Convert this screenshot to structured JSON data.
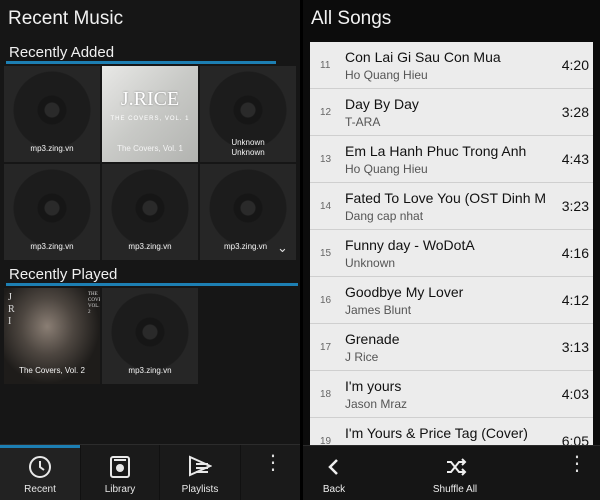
{
  "left_screen": {
    "title": "Recent Music",
    "recently_added": {
      "label": "Recently Added",
      "tiles": [
        {
          "label": "mp3.zing.vn"
        },
        {
          "label": "The Covers, Vol. 1",
          "art_title": "J.RICE",
          "art_sub": "THE COVERS, VOL. 1"
        },
        {
          "label": "Unknown\nUnknown"
        },
        {
          "label": "mp3.zing.vn"
        },
        {
          "label": "mp3.zing.vn"
        },
        {
          "label": "mp3.zing.vn"
        }
      ]
    },
    "recently_played": {
      "label": "Recently Played",
      "tiles": [
        {
          "label": "The Covers, Vol. 2",
          "art_left": "J R I",
          "art_right": "THE COVERS VOL. 2"
        },
        {
          "label": "mp3.zing.vn"
        }
      ]
    },
    "tabs": [
      {
        "label": "Recent",
        "icon": "clock-icon"
      },
      {
        "label": "Library",
        "icon": "library-icon"
      },
      {
        "label": "Playlists",
        "icon": "playlist-icon"
      }
    ],
    "colors": {
      "accent": "#1d7fb3"
    }
  },
  "right_screen": {
    "title": "All Songs",
    "songs": [
      {
        "num": "11",
        "title": "Con Lai Gi Sau Con Mua",
        "artist": "Ho Quang Hieu",
        "duration": "4:20"
      },
      {
        "num": "12",
        "title": "Day By Day",
        "artist": "T-ARA",
        "duration": "3:28"
      },
      {
        "num": "13",
        "title": "Em La Hanh Phuc Trong Anh",
        "artist": "Ho Quang Hieu",
        "duration": "4:43"
      },
      {
        "num": "14",
        "title": "Fated To Love You (OST Dinh Menh)",
        "artist": "Dang cap nhat",
        "duration": "3:23"
      },
      {
        "num": "15",
        "title": "Funny day - WoDotA",
        "artist": "Unknown",
        "duration": "4:16"
      },
      {
        "num": "16",
        "title": "Goodbye My Lover",
        "artist": "James Blunt",
        "duration": "4:12"
      },
      {
        "num": "17",
        "title": "Grenade",
        "artist": "J Rice",
        "duration": "3:13"
      },
      {
        "num": "18",
        "title": "I'm yours",
        "artist": "Jason Mraz",
        "duration": "4:03"
      },
      {
        "num": "19",
        "title": "I'm Yours & Price Tag (Cover)",
        "artist": "",
        "duration": "6:05"
      }
    ],
    "actions": {
      "back": "Back",
      "shuffle": "Shuffle All"
    }
  }
}
